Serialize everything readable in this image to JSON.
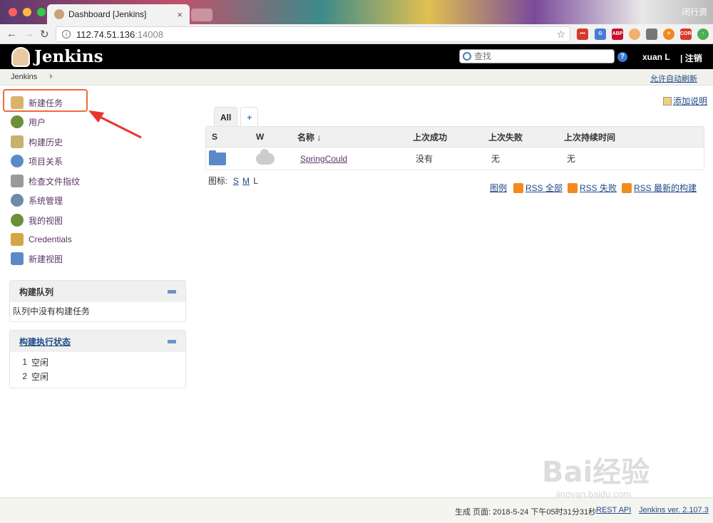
{
  "browser": {
    "tab_title": "Dashboard [Jenkins]",
    "profile_label": "闭行资",
    "url_host": "112.74.51.136",
    "url_port": ":14008",
    "extensions": [
      "ext-1",
      "ext-2",
      "ABP",
      "ext-4",
      "ext-5",
      "ext-6",
      "CORS",
      "ext-8"
    ]
  },
  "header": {
    "brand": "Jenkins",
    "search_placeholder": "查找",
    "help": "?",
    "user": "xuan L",
    "logout": "| 注销"
  },
  "breadcrumb": {
    "root": "Jenkins",
    "auto_refresh": "允许自动刷新"
  },
  "sidebar": {
    "tasks": [
      {
        "label": "新建任务",
        "icon": "new-item-icon",
        "color": "#d9b36a"
      },
      {
        "label": "用户",
        "icon": "people-icon",
        "color": "#6b8f3a"
      },
      {
        "label": "构建历史",
        "icon": "notepad-icon",
        "color": "#c7b26b"
      },
      {
        "label": "项目关系",
        "icon": "search-icon",
        "color": "#5a8bc8"
      },
      {
        "label": "检查文件指纹",
        "icon": "fingerprint-icon",
        "color": "#9a9a9a"
      },
      {
        "label": "系统管理",
        "icon": "gear-icon",
        "color": "#6d8aa8"
      },
      {
        "label": "我的视图",
        "icon": "user-icon",
        "color": "#6b8f3a"
      },
      {
        "label": "Credentials",
        "icon": "credentials-icon",
        "color": "#d4a546"
      },
      {
        "label": "新建视图",
        "icon": "folder-icon",
        "color": "#5a8bc8"
      }
    ],
    "build_queue": {
      "title": "构建队列",
      "empty": "队列中没有构建任务"
    },
    "executors": {
      "title": "构建执行状态",
      "rows": [
        {
          "num": "1",
          "status": "空闲"
        },
        {
          "num": "2",
          "status": "空闲"
        }
      ]
    }
  },
  "main": {
    "add_description": "添加说明",
    "tabs": [
      "All",
      "+"
    ],
    "columns": [
      "S",
      "W",
      "名称 ↓",
      "上次成功",
      "上次失败",
      "上次持续时间"
    ],
    "jobs": [
      {
        "name": "SpringCould",
        "last_success": "没有",
        "last_failure": "无",
        "last_duration": "无"
      }
    ],
    "icon_label": "图标:",
    "icon_sizes": [
      "S",
      "M",
      "L"
    ],
    "legend": "图例",
    "rss": [
      "RSS 全部",
      "RSS 失败",
      "RSS 最新的构建"
    ]
  },
  "footer": {
    "generated": "生成 页面: 2018-5-24 下午05时31分31秒",
    "rest_api": "REST API",
    "version": "Jenkins ver. 2.107.3"
  },
  "watermark": {
    "brand": "Bai经验",
    "url": "jingyan.baidu.com"
  },
  "colors": {
    "accent_highlight": "#ef6a3c",
    "link": "#204a87",
    "visited_link": "#5c3566"
  }
}
